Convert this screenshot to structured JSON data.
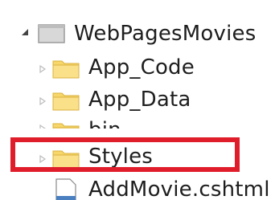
{
  "tree": {
    "root": {
      "label": "WebPagesMovies",
      "icon": "project-icon",
      "expanded": true
    },
    "items": [
      {
        "label": "App_Code",
        "icon": "folder-icon"
      },
      {
        "label": "App_Data",
        "icon": "folder-icon"
      },
      {
        "label": "bin",
        "icon": "folder-icon"
      },
      {
        "label": "Styles",
        "icon": "folder-icon",
        "highlighted": true
      },
      {
        "label": "AddMovie.cshtml",
        "icon": "file-icon"
      }
    ]
  },
  "colors": {
    "highlight_border": "#e01e2b",
    "folder_fill": "#f7d76a",
    "folder_edge": "#d9b23d"
  }
}
